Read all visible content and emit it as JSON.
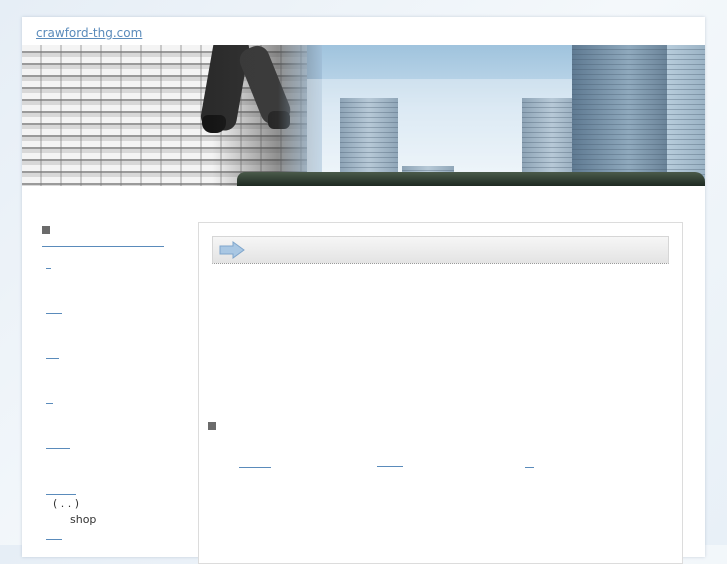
{
  "header": {
    "site_link": "crawford-thg.com"
  },
  "sidebar": {
    "links": [
      {
        "label": ""
      },
      {
        "label": ""
      },
      {
        "label": ""
      },
      {
        "label": ""
      },
      {
        "label": ""
      },
      {
        "label": ""
      },
      {
        "label": ""
      }
    ],
    "note_line1": "( . . )",
    "note_line2": "shop"
  },
  "main": {
    "title": "",
    "section_links": [
      {
        "label": ""
      },
      {
        "label": ""
      },
      {
        "label": ""
      }
    ]
  },
  "colors": {
    "link": "#5a8bbb",
    "bullet": "#6b6b6b",
    "background": "#eef4f9"
  },
  "icons": {
    "title_arrow": "right-arrow-icon",
    "bullet": "square-bullet-icon"
  }
}
